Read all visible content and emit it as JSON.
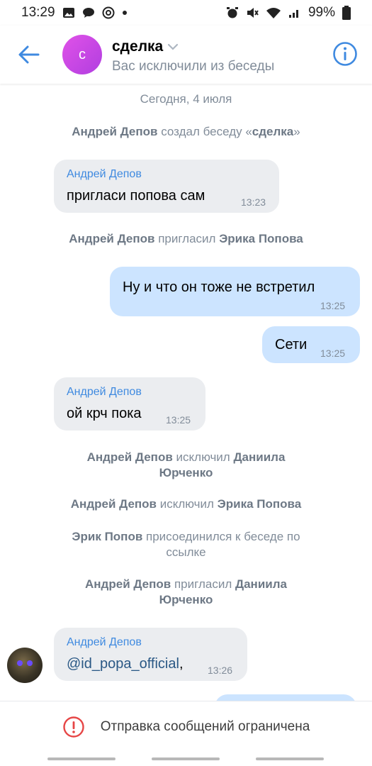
{
  "status_bar": {
    "time": "13:29",
    "battery": "99%"
  },
  "header": {
    "avatar_letter": "с",
    "title": "сделка",
    "subtitle": "Вас исключили из беседы"
  },
  "chat": {
    "date_separator": "Сегодня, 4 июля",
    "system_1": {
      "actor": "Андрей Депов",
      "action": " создал беседу «",
      "target": "сделка",
      "tail": "»"
    },
    "msg_1": {
      "author": "Андрей Депов",
      "text": "пригласи попова сам",
      "time": "13:23"
    },
    "system_2": {
      "actor": "Андрей Депов",
      "action": " пригласил ",
      "target": "Эрика Попова"
    },
    "msg_2": {
      "text": "Ну и что он тоже не встретил",
      "time": "13:25"
    },
    "msg_3": {
      "text": "Сети",
      "time": "13:25"
    },
    "msg_4": {
      "author": "Андрей Депов",
      "text": "ой крч пока",
      "time": "13:25"
    },
    "system_3": {
      "actor": "Андрей Депов",
      "action": " исключил ",
      "target_line1": "Даниила",
      "target_line2": "Юрченко"
    },
    "system_4": {
      "actor": "Андрей Депов",
      "action": " исключил ",
      "target": "Эрика Попова"
    },
    "system_5": {
      "actor": "Эрик Попов",
      "action_line1": " присоединился к беседе по",
      "action_line2": "ссылке"
    },
    "system_6": {
      "actor": "Андрей Депов",
      "action": " пригласил ",
      "target_line1": "Даниила",
      "target_line2": "Юрченко"
    },
    "msg_5": {
      "author": "Андрей Депов",
      "mention": "@id_popa_official",
      "suffix": ",",
      "time": "13:26"
    }
  },
  "bottom": {
    "restriction_text": "Отправка сообщений ограничена"
  },
  "colors": {
    "accent": "#3f8ae0",
    "incoming_bubble": "#ebedf0",
    "outgoing_bubble": "#cce4ff",
    "warning": "#e64646"
  }
}
